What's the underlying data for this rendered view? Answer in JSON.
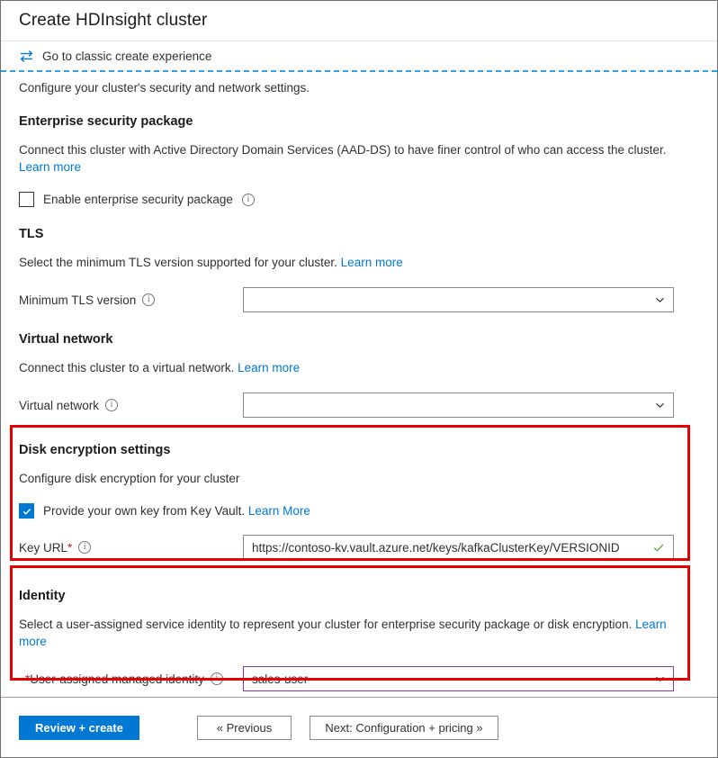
{
  "window": {
    "title": "Create HDInsight cluster"
  },
  "classic_bar": {
    "icon": "swap-arrows-icon",
    "label": "Go to classic create experience"
  },
  "intro": "Configure your cluster's security and network settings.",
  "sections": {
    "esp": {
      "title": "Enterprise security package",
      "description": "Connect this cluster with Active Directory Domain Services (AAD-DS) to have finer control of who can access the cluster. ",
      "learn_more": "Learn more",
      "checkbox": {
        "label": "Enable enterprise security package",
        "checked": false,
        "info": "i"
      }
    },
    "tls": {
      "title": "TLS",
      "description": "Select the minimum TLS version supported for your cluster. ",
      "learn_more": "Learn more",
      "field": {
        "label": "Minimum TLS version",
        "value": "",
        "info": "i"
      }
    },
    "vnet": {
      "title": "Virtual network",
      "description": "Connect this cluster to a virtual network. ",
      "learn_more": "Learn more",
      "field": {
        "label": "Virtual network",
        "value": "",
        "info": "i"
      }
    },
    "disk": {
      "title": "Disk encryption settings",
      "description": "Configure disk encryption for your cluster",
      "checkbox": {
        "label": "Provide your own key from Key Vault.",
        "learn_more": "Learn More",
        "checked": true
      },
      "field": {
        "label": "Key URL",
        "required_marker": "*",
        "info": "i",
        "value": "https://contoso-kv.vault.azure.net/keys/kafkaClusterKey/VERSIONID",
        "validation": "valid-check-icon"
      }
    },
    "identity": {
      "title": "Identity",
      "description": "Select a user-assigned service identity to represent your cluster for enterprise security package or disk encryption. ",
      "learn_more": "Learn more",
      "field": {
        "required_marker": "*",
        "label": "User-assigned managed identity",
        "info": "i",
        "value": "sales-user"
      }
    }
  },
  "footer": {
    "review_create": "Review + create",
    "previous": "« Previous",
    "next": "Next: Configuration + pricing »"
  },
  "colors": {
    "accent_blue": "#0078d4",
    "link_blue": "#0078d4",
    "highlight_red": "#e60000",
    "required_red": "#a4262c",
    "purple_border": "#8a3a9e",
    "valid_green": "#6aa84f",
    "dashed_blue": "#29a3e3"
  }
}
